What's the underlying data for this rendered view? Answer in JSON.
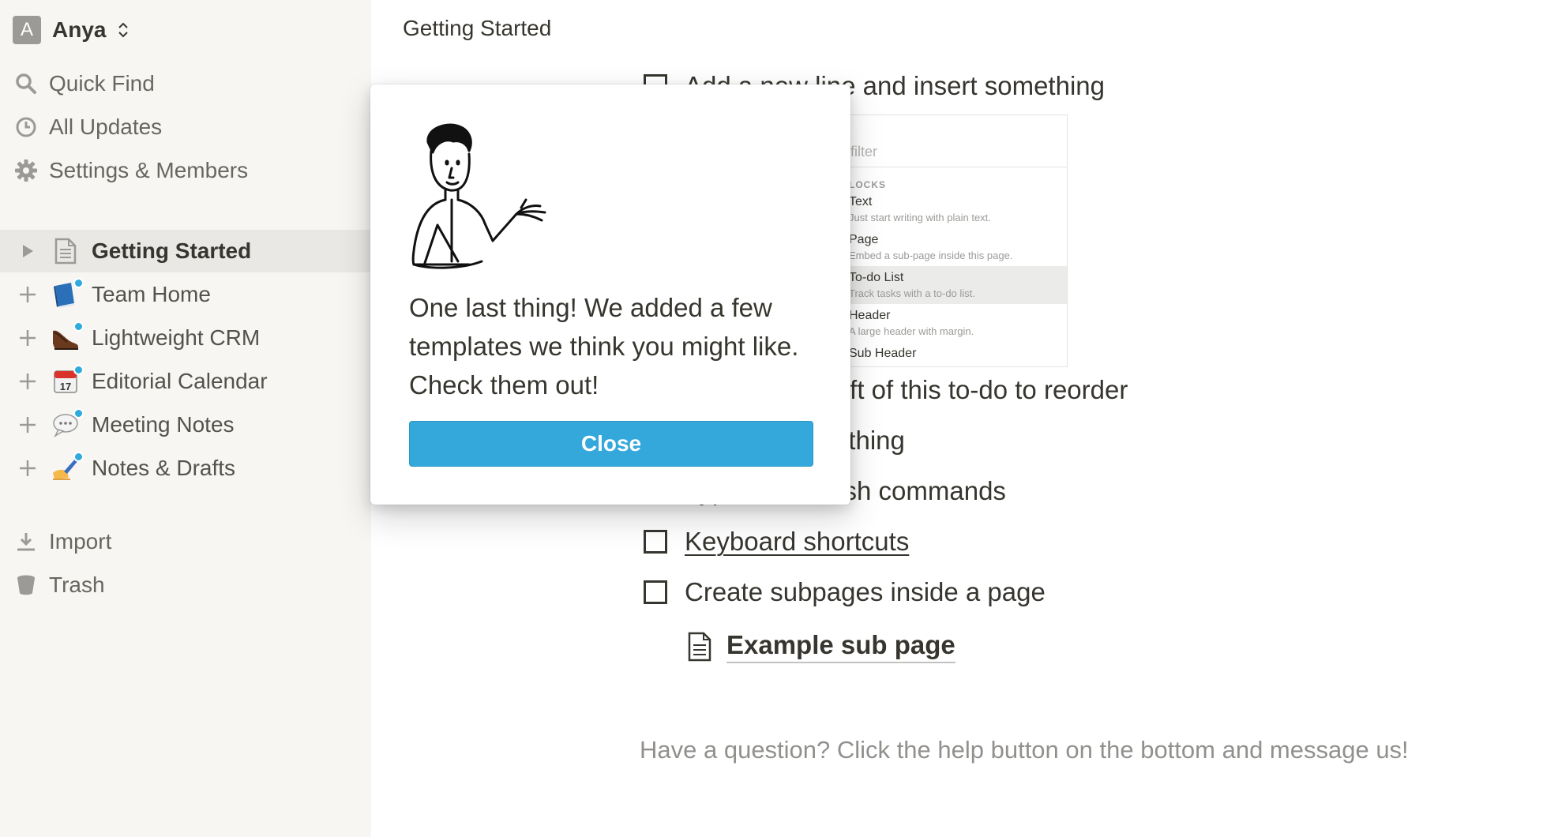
{
  "workspace": {
    "avatar_letter": "A",
    "name": "Anya"
  },
  "sidebar": {
    "nav": [
      {
        "label": "Quick Find",
        "icon": "search-icon"
      },
      {
        "label": "All Updates",
        "icon": "clock-icon"
      },
      {
        "label": "Settings & Members",
        "icon": "gear-icon"
      }
    ],
    "pages": [
      {
        "label": "Getting Started",
        "icon": "document-icon",
        "active": true
      },
      {
        "label": "Team Home",
        "icon": "blue-book-emoji"
      },
      {
        "label": "Lightweight CRM",
        "icon": "shoe-emoji"
      },
      {
        "label": "Editorial Calendar",
        "icon": "calendar-emoji",
        "icon_text": "17"
      },
      {
        "label": "Meeting Notes",
        "icon": "speech-bubble-emoji"
      },
      {
        "label": "Notes & Drafts",
        "icon": "writing-hand-emoji"
      }
    ],
    "footer": [
      {
        "label": "Import",
        "icon": "download-icon"
      },
      {
        "label": "Trash",
        "icon": "trash-icon"
      }
    ]
  },
  "main": {
    "title": "Getting Started",
    "todos": [
      {
        "label": "Add a new line and insert something"
      },
      {
        "label": "utton on the left of this to-do to reorder"
      },
      {
        "label": "d delete something"
      },
      {
        "label": "Type '/' for slash commands"
      },
      {
        "label": "Keyboard shortcuts",
        "underlined": true
      },
      {
        "label": "Create subpages inside a page"
      }
    ],
    "subpage": {
      "label": "Example sub page"
    },
    "help_text": "Have a question? Click the help button on the bottom and message us!",
    "menu_shot": {
      "filter_placeholder": "filter",
      "section": "LOCKS",
      "items": [
        {
          "title": "Text",
          "desc": "Just start writing with plain text."
        },
        {
          "title": "Page",
          "desc": "Embed a sub-page inside this page."
        },
        {
          "title": "To-do List",
          "desc": "Track tasks with a to-do list."
        },
        {
          "title": "Header",
          "desc": "A large header with margin."
        },
        {
          "title": "Sub Header",
          "desc": ""
        }
      ]
    }
  },
  "popup": {
    "message": "One last thing! We added a few templates we think you might like. Check them out!",
    "close_label": "Close"
  },
  "colors": {
    "accent": "#34a8db",
    "badge": "#2eaadc",
    "sidebar_bg": "#f7f6f3"
  }
}
